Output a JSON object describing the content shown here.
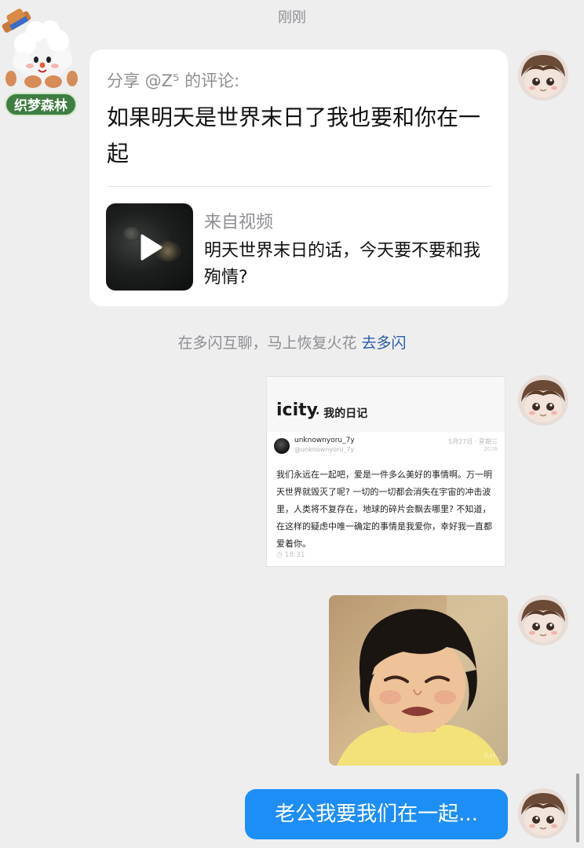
{
  "timestamp": "刚刚",
  "left_user": {
    "badge": "织梦森林"
  },
  "share_card": {
    "header": "分享 @Z⁵ 的评论:",
    "comment": "如果明天是世界末日了我也要和你在一起",
    "from_label": "来自视频",
    "video_title": "明天世界末日的话，今天要不要和我殉情?"
  },
  "hint": {
    "text": "在多闪互聊，马上恢复火花 ",
    "link": "去多闪"
  },
  "icity": {
    "logo": "icity",
    "subtitle": "· 我的日记",
    "username": "unknownyoru_7y",
    "handle": "@unknownyoru_7y",
    "date": "5月27日 · 星期三",
    "year": "2026",
    "body": "我们永远在一起吧，爱是一件多么美好的事情啊。万一明天世界就毁灭了呢? 一切的一切都会消失在宇宙的冲击波里，人类将不复存在，地球的碎片会飘去哪里? 不知道，在这样的疑虑中唯一确定的事情是我爱你，幸好我一直都爱着你。",
    "time": "18:31"
  },
  "photo": {
    "watermark": "Ikat..."
  },
  "sent_message": "老公我要我们在一起..."
}
